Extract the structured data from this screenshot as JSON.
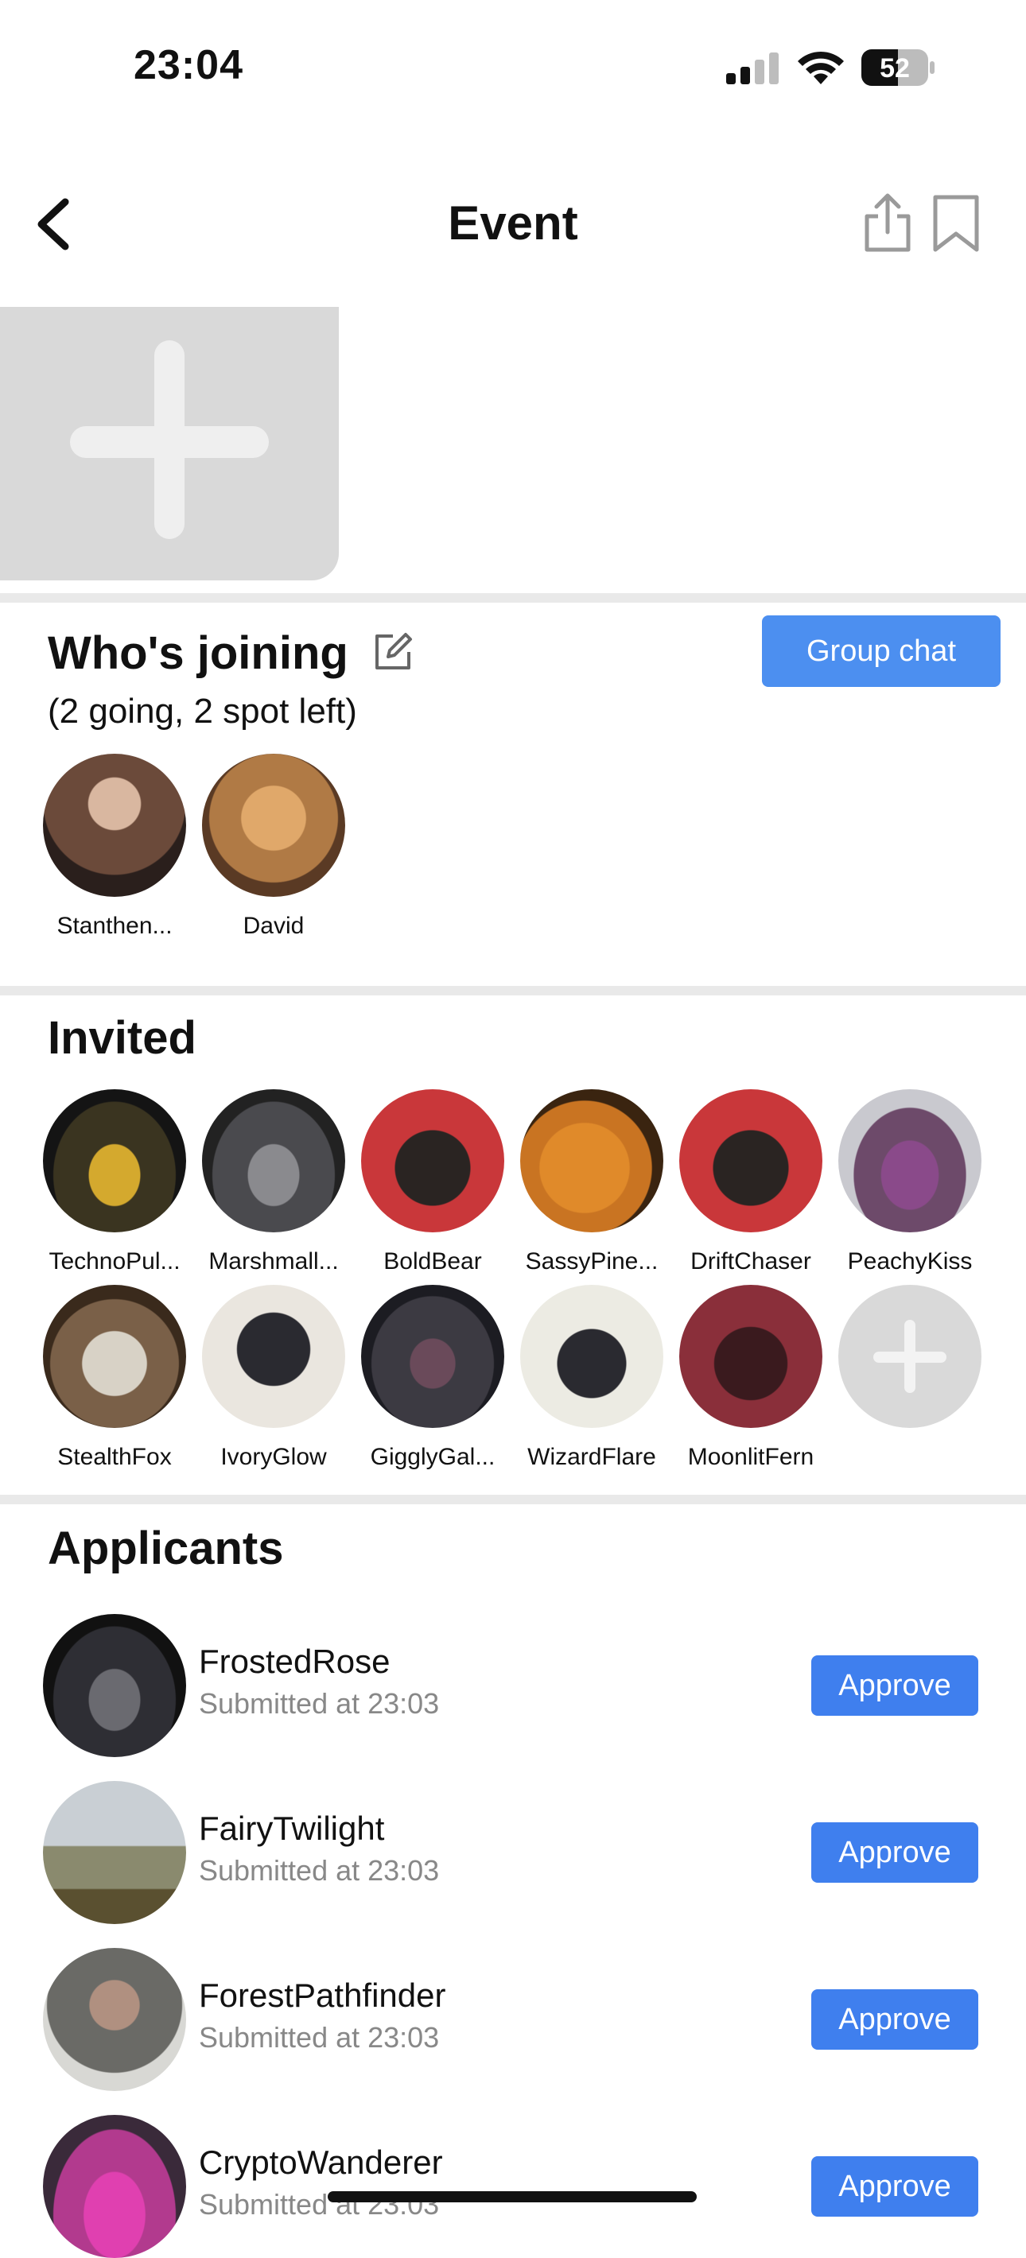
{
  "status_bar": {
    "time": "23:04",
    "battery": "52"
  },
  "header": {
    "title": "Event",
    "back_icon": "chevron-left-icon",
    "share_icon": "share-icon",
    "bookmark_icon": "bookmark-icon"
  },
  "whos_joining": {
    "title": "Who's joining",
    "subtitle": "(2 going, 2 spot left)",
    "group_chat_label": "Group chat",
    "members": [
      {
        "name": "Stanthen...",
        "color": "#6b4a3a"
      },
      {
        "name": "David",
        "color": "#b07a45"
      }
    ]
  },
  "invited": {
    "title": "Invited",
    "people": [
      {
        "name": "TechnoPul...",
        "color": "#3a3420"
      },
      {
        "name": "Marshmall...",
        "color": "#4a4a4e"
      },
      {
        "name": "BoldBear",
        "color": "#c9373a"
      },
      {
        "name": "SassyPine...",
        "color": "#c97422"
      },
      {
        "name": "DriftChaser",
        "color": "#c9373a"
      },
      {
        "name": "PeachyKiss",
        "color": "#6d4a6a"
      },
      {
        "name": "StealthFox",
        "color": "#7a6048"
      },
      {
        "name": "IvoryGlow",
        "color": "#eae6df"
      },
      {
        "name": "GigglyGal...",
        "color": "#3c3a42"
      },
      {
        "name": "WizardFlare",
        "color": "#ecebe3"
      },
      {
        "name": "MoonlitFern",
        "color": "#8a2f3a"
      }
    ]
  },
  "applicants": {
    "title": "Applicants",
    "approve_label": "Approve",
    "list": [
      {
        "name": "FrostedRose",
        "submitted": "Submitted at 23:03",
        "color": "#2e2e34"
      },
      {
        "name": "FairyTwilight",
        "submitted": "Submitted at 23:03",
        "color": "#8a8a6e"
      },
      {
        "name": "ForestPathfinder",
        "submitted": "Submitted at 23:03",
        "color": "#6a6a66"
      },
      {
        "name": "CryptoWanderer",
        "submitted": "Submitted at 23:03",
        "color": "#b23a8e"
      }
    ]
  }
}
